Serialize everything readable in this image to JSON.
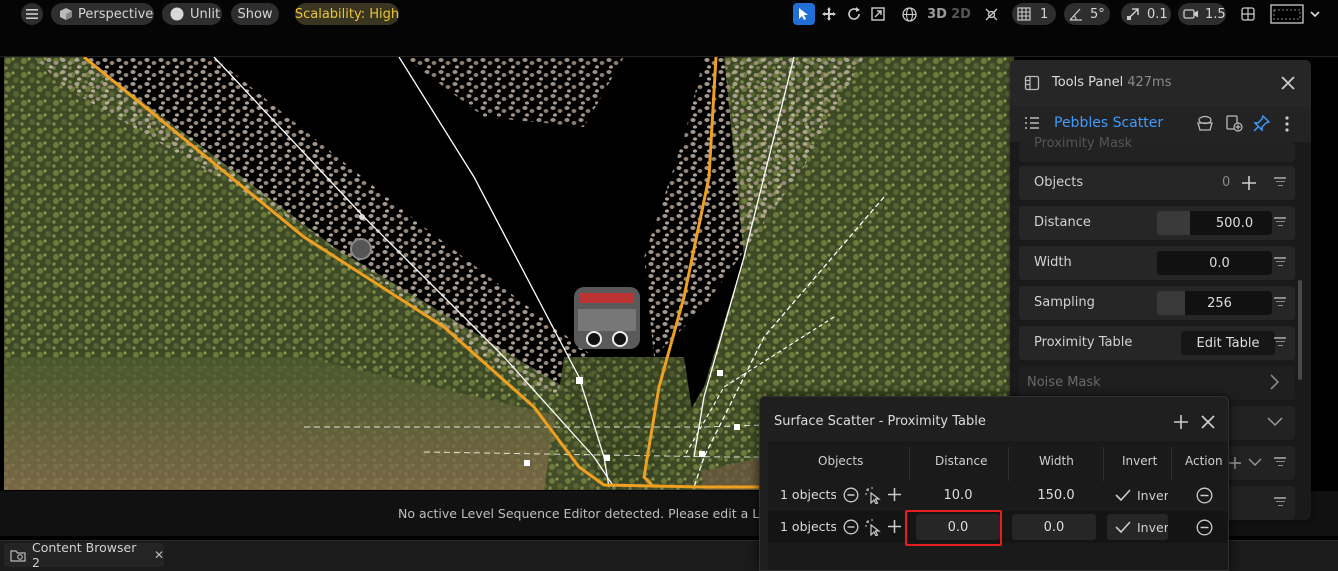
{
  "toolbar": {
    "perspective_label": "Perspective",
    "unlit_label": "Unlit",
    "show_label": "Show",
    "scalability_label": "Scalability: High",
    "view_3d": "3D",
    "view_2d": "2D",
    "grid_value": "1",
    "angle_value": "5°",
    "scale_value": "0.1",
    "camera_speed": "1.5"
  },
  "viewport": {
    "status_message": "No active Level Sequence Editor detected. Please edit a Level S"
  },
  "tools_panel": {
    "title": "Tools Panel",
    "time": "427ms",
    "tool_name": "Pebbles Scatter",
    "clipped_label": "Proximity Mask",
    "rows": {
      "objects_label": "Objects",
      "objects_count": "0",
      "distance_label": "Distance",
      "distance_value": "500.0",
      "width_label": "Width",
      "width_value": "0.0",
      "sampling_label": "Sampling",
      "sampling_value": "256",
      "proximity_table_label": "Proximity Table",
      "edit_table_label": "Edit Table",
      "noise_mask_label": "Noise Mask"
    }
  },
  "proximity_table": {
    "title": "Surface Scatter - Proximity Table",
    "columns": [
      "Objects",
      "Distance",
      "Width",
      "Invert",
      "Action"
    ],
    "rows": [
      {
        "objects": "1 objects",
        "distance": "10.0",
        "width": "150.0",
        "invert": "Invert"
      },
      {
        "objects": "1 objects",
        "distance": "0.0",
        "width": "0.0",
        "invert": "Invert"
      }
    ]
  },
  "bottom_bar": {
    "content_browser_tab": "Content Browser 2"
  },
  "colors": {
    "accent_blue": "#3e9bff",
    "scalability_yellow": "#e8c53a",
    "spline_orange": "#f0a020",
    "highlight_red": "#e31e1e"
  }
}
